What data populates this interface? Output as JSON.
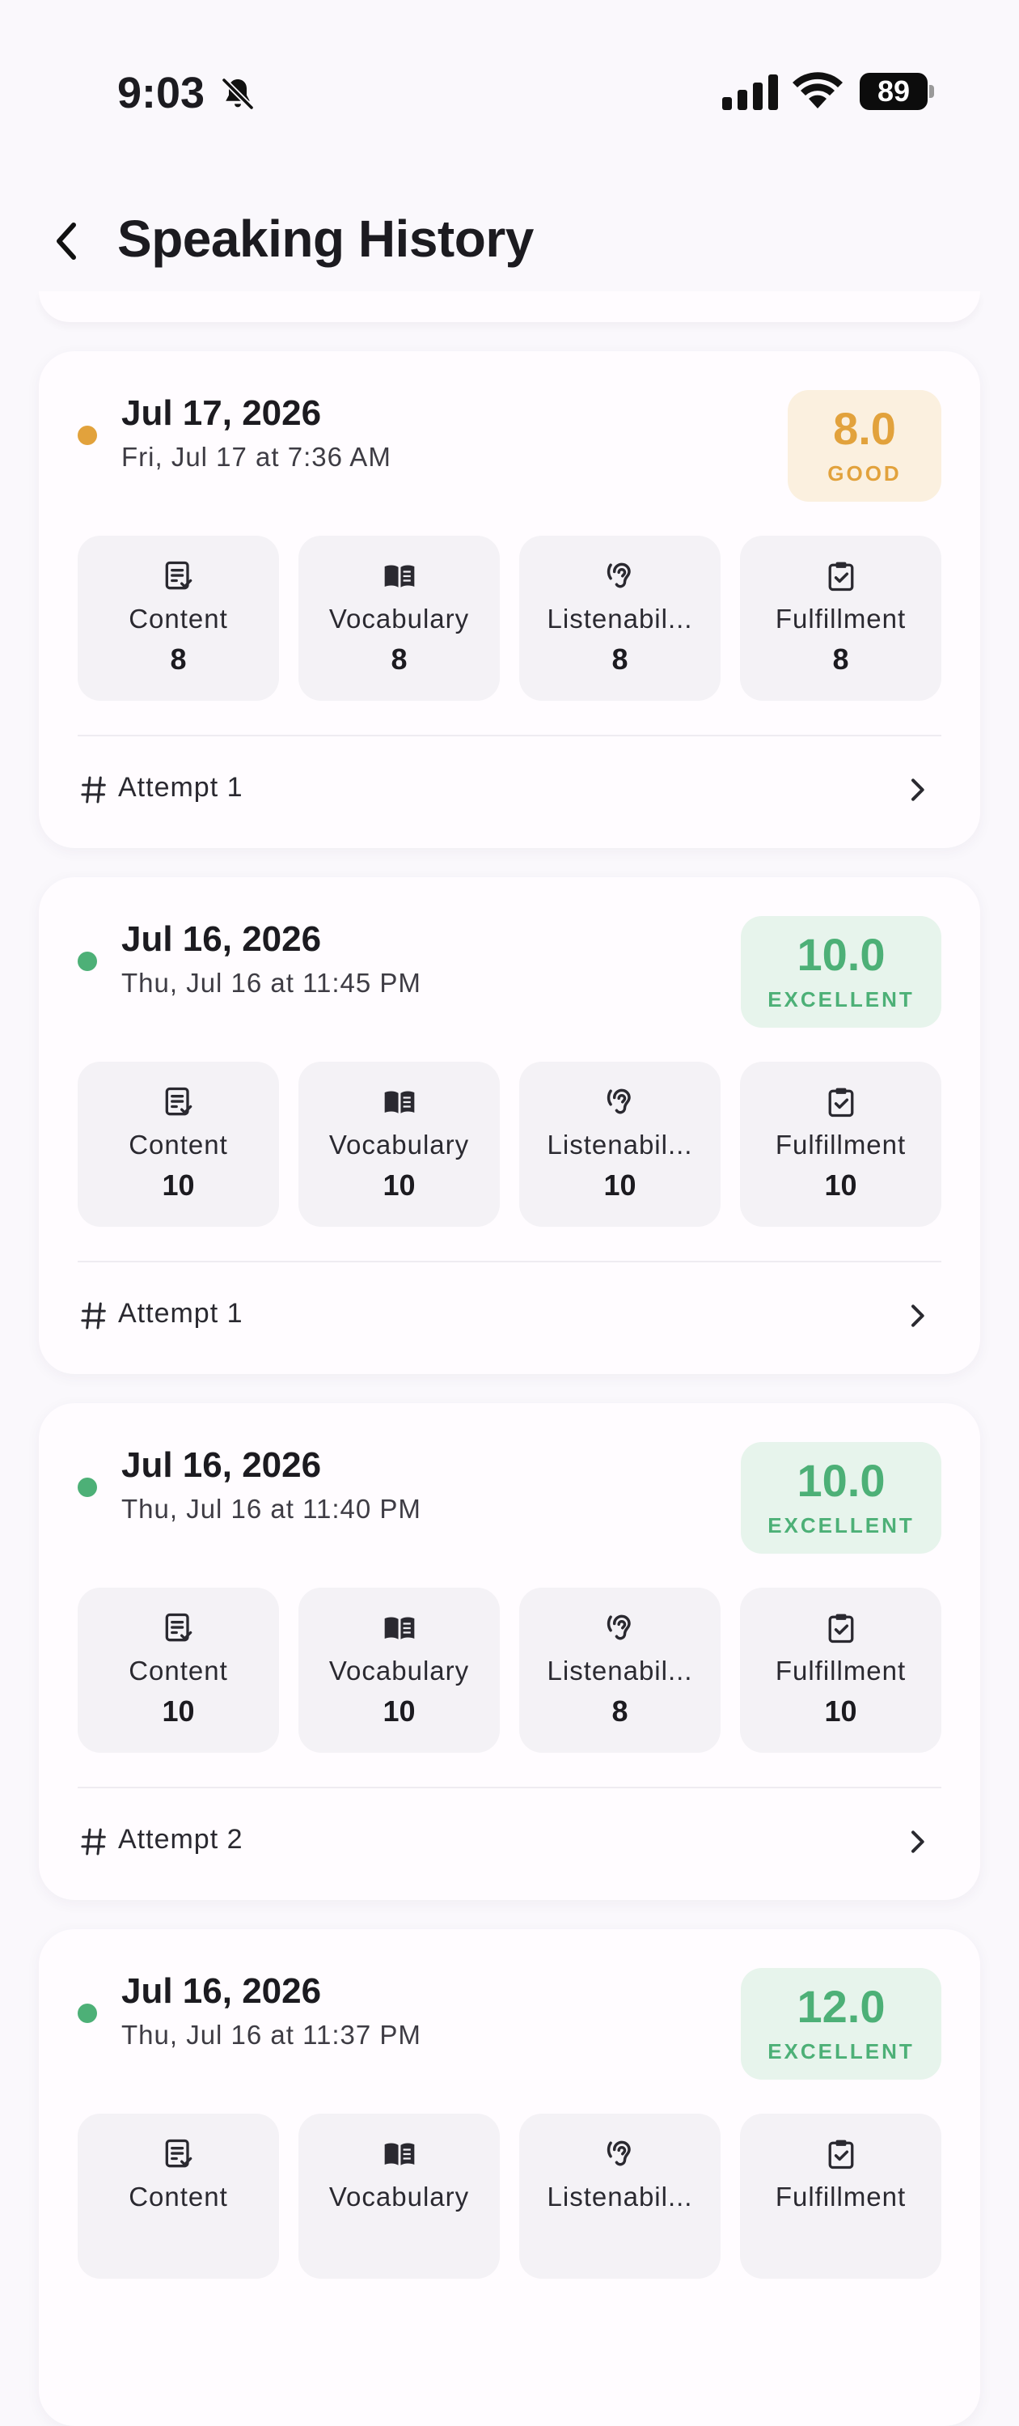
{
  "status": {
    "time": "9:03",
    "battery": "89"
  },
  "header": {
    "title": "Speaking History"
  },
  "colors": {
    "good": "#E2A23C",
    "excellent": "#4DB077"
  },
  "cards": [
    {
      "date": "Jul 17, 2026",
      "subdate": "Fri, Jul 17 at 7:36 AM",
      "score": "8.0",
      "rating": "GOOD",
      "metrics": [
        {
          "name": "Content",
          "value": "8",
          "icon": "content-icon"
        },
        {
          "name": "Vocabulary",
          "value": "8",
          "icon": "book-icon"
        },
        {
          "name": "Listenabil...",
          "value": "8",
          "icon": "ear-icon"
        },
        {
          "name": "Fulfillment",
          "value": "8",
          "icon": "clipboard-check-icon"
        }
      ],
      "attempt": "Attempt 1"
    },
    {
      "date": "Jul 16, 2026",
      "subdate": "Thu, Jul 16 at 11:45 PM",
      "score": "10.0",
      "rating": "EXCELLENT",
      "metrics": [
        {
          "name": "Content",
          "value": "10",
          "icon": "content-icon"
        },
        {
          "name": "Vocabulary",
          "value": "10",
          "icon": "book-icon"
        },
        {
          "name": "Listenabil...",
          "value": "10",
          "icon": "ear-icon"
        },
        {
          "name": "Fulfillment",
          "value": "10",
          "icon": "clipboard-check-icon"
        }
      ],
      "attempt": "Attempt 1"
    },
    {
      "date": "Jul 16, 2026",
      "subdate": "Thu, Jul 16 at 11:40 PM",
      "score": "10.0",
      "rating": "EXCELLENT",
      "metrics": [
        {
          "name": "Content",
          "value": "10",
          "icon": "content-icon"
        },
        {
          "name": "Vocabulary",
          "value": "10",
          "icon": "book-icon"
        },
        {
          "name": "Listenabil...",
          "value": "8",
          "icon": "ear-icon"
        },
        {
          "name": "Fulfillment",
          "value": "10",
          "icon": "clipboard-check-icon"
        }
      ],
      "attempt": "Attempt 2"
    },
    {
      "date": "Jul 16, 2026",
      "subdate": "Thu, Jul 16 at 11:37 PM",
      "score": "12.0",
      "rating": "EXCELLENT",
      "metrics": [
        {
          "name": "Content",
          "value": "",
          "icon": "content-icon"
        },
        {
          "name": "Vocabulary",
          "value": "",
          "icon": "book-icon"
        },
        {
          "name": "Listenabil...",
          "value": "",
          "icon": "ear-icon"
        },
        {
          "name": "Fulfillment",
          "value": "",
          "icon": "clipboard-check-icon"
        }
      ],
      "attempt": ""
    }
  ]
}
